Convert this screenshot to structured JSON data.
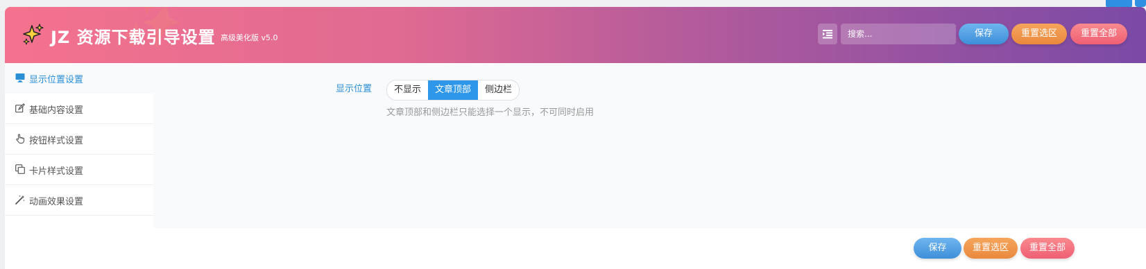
{
  "header": {
    "title": "JZ 资源下载引导设置",
    "subtitle": "高级美化版 v5.0",
    "search_placeholder": "搜索...",
    "save_label": "保存",
    "reset_selected_label": "重置选区",
    "reset_all_label": "重置全部",
    "logo_icon": "sparkles-icon",
    "menu_icon": "list-indent-icon"
  },
  "sidebar": {
    "items": [
      {
        "label": "显示位置设置",
        "icon": "monitor-icon",
        "active": true
      },
      {
        "label": "基础内容设置",
        "icon": "edit-icon",
        "active": false
      },
      {
        "label": "按钮样式设置",
        "icon": "pointer-hand-icon",
        "active": false
      },
      {
        "label": "卡片样式设置",
        "icon": "copy-icon",
        "active": false
      },
      {
        "label": "动画效果设置",
        "icon": "magic-wand-icon",
        "active": false
      }
    ]
  },
  "content": {
    "display_position": {
      "label": "显示位置",
      "options": [
        "不显示",
        "文章顶部",
        "侧边栏"
      ],
      "selected": "文章顶部",
      "hint": "文章顶部和侧边栏只能选择一个显示，不可同时启用"
    }
  },
  "footer": {
    "save_label": "保存",
    "reset_selected_label": "重置选区",
    "reset_all_label": "重置全部"
  },
  "colors": {
    "accent": "#2f97ea",
    "save": "#4a9ee3",
    "reset_selected": "#ee9447",
    "reset_all": "#f26c7e",
    "header_start": "#f4728e",
    "header_end": "#7a4aa6"
  }
}
